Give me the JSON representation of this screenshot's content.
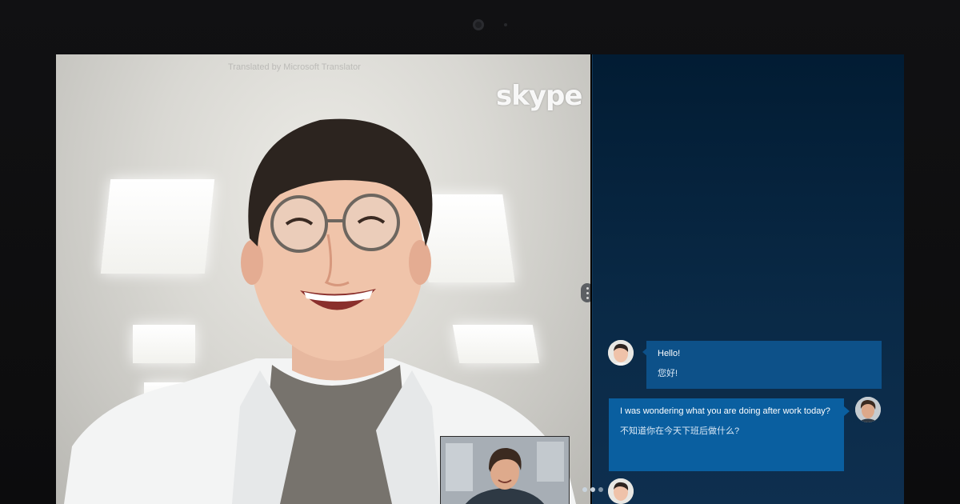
{
  "device": {
    "camera": "front-camera"
  },
  "video_call": {
    "watermark": "Translated by Microsoft Translator",
    "brand": "skype",
    "remote_participant": "remote-video-feed",
    "self_view": "self-video-preview"
  },
  "chat": {
    "messages": [
      {
        "direction": "incoming",
        "text": "Hello!",
        "translation": "您好!"
      },
      {
        "direction": "outgoing",
        "text": "I was wondering what you are doing after work today?",
        "translation": "不知道你在今天下班后做什么?"
      }
    ],
    "typing_indicator": "typing-dots-icon"
  },
  "colors": {
    "chat_background": "#021c33",
    "bubble_outgoing": "#0a5fa0",
    "bubble_incoming": "#0d5189",
    "bezel": "#0a0a0b"
  }
}
